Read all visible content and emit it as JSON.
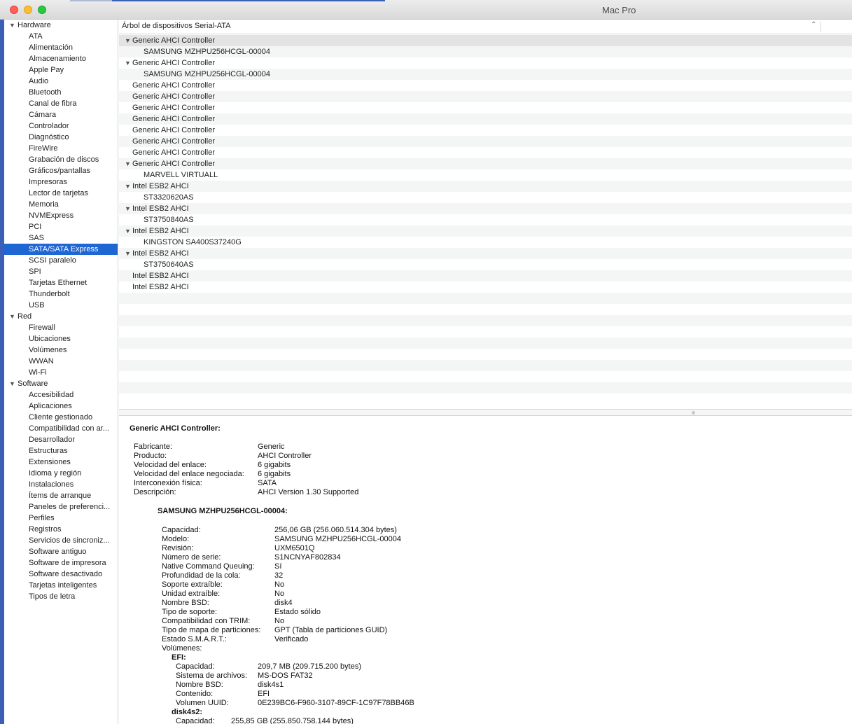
{
  "window": {
    "title": "Mac Pro"
  },
  "sidebar": {
    "groups": [
      {
        "label": "Hardware",
        "items": [
          "ATA",
          "Alimentación",
          "Almacenamiento",
          "Apple Pay",
          "Audio",
          "Bluetooth",
          "Canal de fibra",
          "Cámara",
          "Controlador",
          "Diagnóstico",
          "FireWire",
          "Grabación de discos",
          "Gráficos/pantallas",
          "Impresoras",
          "Lector de tarjetas",
          "Memoria",
          "NVMExpress",
          "PCI",
          "SAS",
          "SATA/SATA Express",
          "SCSI paralelo",
          "SPI",
          "Tarjetas Ethernet",
          "Thunderbolt",
          "USB"
        ]
      },
      {
        "label": "Red",
        "items": [
          "Firewall",
          "Ubicaciones",
          "Volúmenes",
          "WWAN",
          "Wi-Fi"
        ]
      },
      {
        "label": "Software",
        "items": [
          "Accesibilidad",
          "Aplicaciones",
          "Cliente gestionado",
          "Compatibilidad con ar...",
          "Desarrollador",
          "Estructuras",
          "Extensiones",
          "Idioma y región",
          "Instalaciones",
          "Ítems de arranque",
          "Paneles de preferenci...",
          "Perfiles",
          "Registros",
          "Servicios de sincroniz...",
          "Software antiguo",
          "Software de impresora",
          "Software desactivado",
          "Tarjetas inteligentes",
          "Tipos de letra"
        ]
      }
    ],
    "selected": "SATA/SATA Express"
  },
  "tree": {
    "header": "Árbol de dispositivos Serial-ATA",
    "sort_glyph": "⌃",
    "rows": [
      {
        "label": "Generic AHCI Controller",
        "level": 0,
        "expanded": true
      },
      {
        "label": "SAMSUNG MZHPU256HCGL-00004",
        "level": 1
      },
      {
        "label": "Generic AHCI Controller",
        "level": 0,
        "expanded": true
      },
      {
        "label": "SAMSUNG MZHPU256HCGL-00004",
        "level": 1
      },
      {
        "label": "Generic AHCI Controller",
        "level": 0
      },
      {
        "label": "Generic AHCI Controller",
        "level": 0
      },
      {
        "label": "Generic AHCI Controller",
        "level": 0
      },
      {
        "label": "Generic AHCI Controller",
        "level": 0
      },
      {
        "label": "Generic AHCI Controller",
        "level": 0
      },
      {
        "label": "Generic AHCI Controller",
        "level": 0
      },
      {
        "label": "Generic AHCI Controller",
        "level": 0
      },
      {
        "label": "Generic AHCI Controller",
        "level": 0,
        "expanded": true
      },
      {
        "label": "MARVELL VIRTUALL",
        "level": 1
      },
      {
        "label": "Intel ESB2 AHCI",
        "level": 0,
        "expanded": true
      },
      {
        "label": "ST3320620AS",
        "level": 1
      },
      {
        "label": "Intel ESB2 AHCI",
        "level": 0,
        "expanded": true
      },
      {
        "label": "ST3750840AS",
        "level": 1
      },
      {
        "label": "Intel ESB2 AHCI",
        "level": 0,
        "expanded": true
      },
      {
        "label": "KINGSTON SA400S37240G",
        "level": 1
      },
      {
        "label": "Intel ESB2 AHCI",
        "level": 0,
        "expanded": true
      },
      {
        "label": "ST3750640AS",
        "level": 1
      },
      {
        "label": "Intel ESB2 AHCI",
        "level": 0
      },
      {
        "label": "Intel ESB2 AHCI",
        "level": 0
      }
    ]
  },
  "detail": {
    "title": "Generic AHCI Controller:",
    "controller_props": [
      {
        "k": "Fabricante:",
        "v": "Generic"
      },
      {
        "k": "Producto:",
        "v": "AHCI Controller"
      },
      {
        "k": "Velocidad del enlace:",
        "v": "6 gigabits"
      },
      {
        "k": "Velocidad del enlace negociada:",
        "v": "6 gigabits"
      },
      {
        "k": "Interconexión física:",
        "v": "SATA"
      },
      {
        "k": "Descripción:",
        "v": "AHCI Version 1.30 Supported"
      }
    ],
    "device_title": "SAMSUNG MZHPU256HCGL-00004:",
    "device_props": [
      {
        "k": "Capacidad:",
        "v": "256,06 GB (256.060.514.304 bytes)"
      },
      {
        "k": "Modelo:",
        "v": "SAMSUNG MZHPU256HCGL-00004"
      },
      {
        "k": "Revisión:",
        "v": "UXM6501Q"
      },
      {
        "k": "Número de serie:",
        "v": "S1NCNYAF802834"
      },
      {
        "k": "Native Command Queuing:",
        "v": "Sí"
      },
      {
        "k": "Profundidad de la cola:",
        "v": "32"
      },
      {
        "k": "Soporte extraíble:",
        "v": "No"
      },
      {
        "k": "Unidad extraíble:",
        "v": "No"
      },
      {
        "k": "Nombre BSD:",
        "v": "disk4"
      },
      {
        "k": "Tipo de soporte:",
        "v": "Estado sólido"
      },
      {
        "k": "Compatibilidad con TRIM:",
        "v": "No"
      },
      {
        "k": "Tipo de mapa de particiones:",
        "v": "GPT (Tabla de particiones GUID)"
      },
      {
        "k": "Estado S.M.A.R.T.:",
        "v": "Verificado"
      }
    ],
    "volumes_label": "Volúmenes:",
    "volume_efi": {
      "name": "EFI:",
      "props": [
        {
          "k": "Capacidad:",
          "v": "209,7 MB (209.715.200 bytes)"
        },
        {
          "k": "Sistema de archivos:",
          "v": "MS-DOS FAT32"
        },
        {
          "k": "Nombre BSD:",
          "v": "disk4s1"
        },
        {
          "k": "Contenido:",
          "v": "EFI"
        },
        {
          "k": "Volumen UUID:",
          "v": "0E239BC6-F960-3107-89CF-1C97F78BB46B"
        }
      ]
    },
    "volume_disk4s2": {
      "name": "disk4s2:",
      "props": [
        {
          "k": "Capacidad:",
          "v": "255,85 GB (255.850.758.144 bytes)"
        }
      ]
    }
  }
}
